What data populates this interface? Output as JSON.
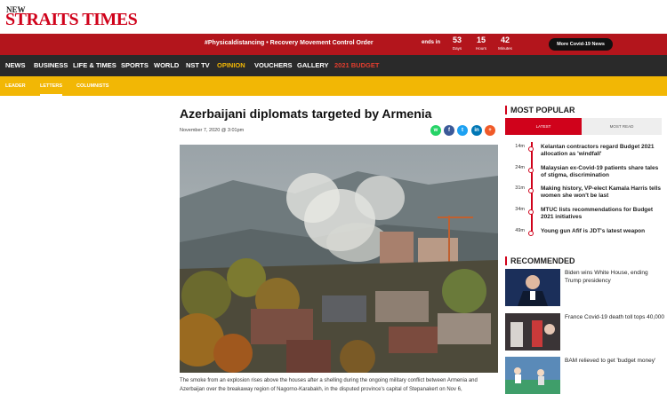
{
  "logo": {
    "small": "NEW",
    "main": "STRAITS TIMES",
    "tagline": ""
  },
  "promo": {
    "text": "#Physicaldistancing • Recovery Movement Control Order",
    "ends_in": "ends in",
    "countdown": [
      {
        "value": "53",
        "label": "Days"
      },
      {
        "value": "15",
        "label": "Hours"
      },
      {
        "value": "42",
        "label": "Minutes"
      }
    ],
    "button": "More Covid-19 News"
  },
  "nav": [
    {
      "label": "NEWS",
      "state": "normal"
    },
    {
      "label": "BUSINESS",
      "state": "normal"
    },
    {
      "label": "LIFE & TIMES",
      "state": "normal"
    },
    {
      "label": "SPORTS",
      "state": "normal"
    },
    {
      "label": "WORLD",
      "state": "normal"
    },
    {
      "label": "NST TV",
      "state": "normal"
    },
    {
      "label": "OPINION",
      "state": "active"
    },
    {
      "label": "VOUCHERS",
      "state": "normal"
    },
    {
      "label": "GALLERY",
      "state": "normal"
    },
    {
      "label": "2021 BUDGET",
      "state": "budget"
    }
  ],
  "subnav": [
    "LEADER",
    "LETTERS",
    "COLUMNISTS"
  ],
  "article": {
    "headline": "Azerbaijani diplomats targeted by Armenia",
    "date": "November 7, 2020 @ 3:01pm",
    "caption": "The smoke from an explosion rises above the houses after a shelling during the ongoing military conflict between Armenia and Azerbaijan over the breakaway region of Nagorno-Karabakh, in the disputed province's capital of Stepanakert on Nov 6,"
  },
  "share": [
    {
      "icon": "whatsapp-icon",
      "glyph": "w",
      "color": "#25d366"
    },
    {
      "icon": "facebook-icon",
      "glyph": "f",
      "color": "#3b5998"
    },
    {
      "icon": "twitter-icon",
      "glyph": "t",
      "color": "#1da1f2"
    },
    {
      "icon": "linkedin-icon",
      "glyph": "in",
      "color": "#0077b5"
    },
    {
      "icon": "more-share-icon",
      "glyph": "+",
      "color": "#f05a28"
    }
  ],
  "most_popular": {
    "title": "MOST POPULAR",
    "tabs": [
      "LATEST",
      "MOST READ"
    ],
    "items": [
      {
        "time": "14m",
        "title": "Kelantan contractors regard Budget 2021 allocation as 'windfall'"
      },
      {
        "time": "24m",
        "title": "Malaysian ex-Covid-19 patients share tales of stigma, discrimination"
      },
      {
        "time": "31m",
        "title": "Making history, VP-elect Kamala Harris tells women she won't be last"
      },
      {
        "time": "34m",
        "title": "MTUC lists recommendations for Budget 2021 initiatives"
      },
      {
        "time": "49m",
        "title": "Young gun Afif is JDT's latest weapon"
      }
    ]
  },
  "recommended": {
    "title": "RECOMMENDED",
    "items": [
      {
        "title": "Biden wins White House, ending Trump presidency"
      },
      {
        "title": "France Covid-19 death toll tops 40,000"
      },
      {
        "title": "BAM relieved to get 'budget money'"
      }
    ]
  },
  "colors": {
    "brand_red": "#d0021b",
    "promo_red": "#b3151c",
    "nav_dark": "#2a2a2a",
    "accent_yellow": "#f2b705"
  }
}
